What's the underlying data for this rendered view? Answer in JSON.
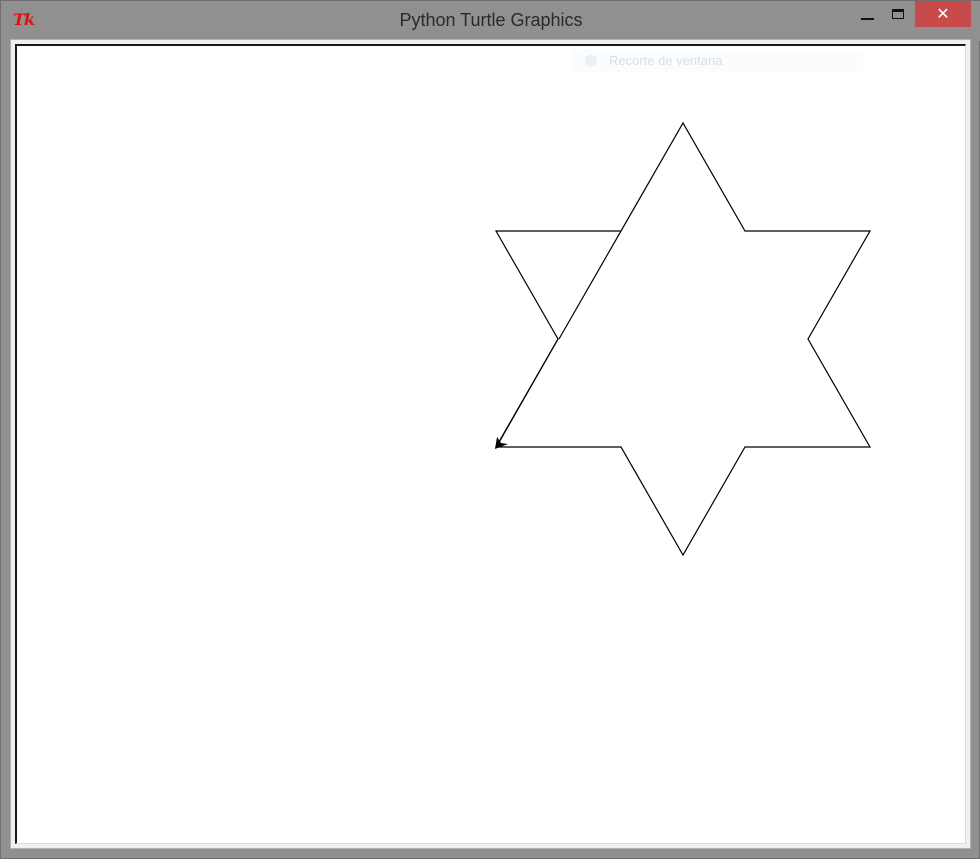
{
  "window": {
    "title": "Python Turtle Graphics",
    "app_icon": "tk-icon",
    "app_icon_text": "Tk",
    "controls": {
      "minimize_icon": "minimize-icon",
      "maximize_icon": "maximize-icon",
      "close_icon": "close-icon",
      "close_glyph": "✕"
    },
    "close_color": "#c94a4a"
  },
  "overlay": {
    "text": "Recorte de ventana"
  },
  "canvas": {
    "background": "#ffffff",
    "drawing": {
      "shape": "six-pointed star",
      "stroke": "#000000"
    },
    "turtle": {
      "shape": "arrow",
      "color": "#000000"
    }
  }
}
